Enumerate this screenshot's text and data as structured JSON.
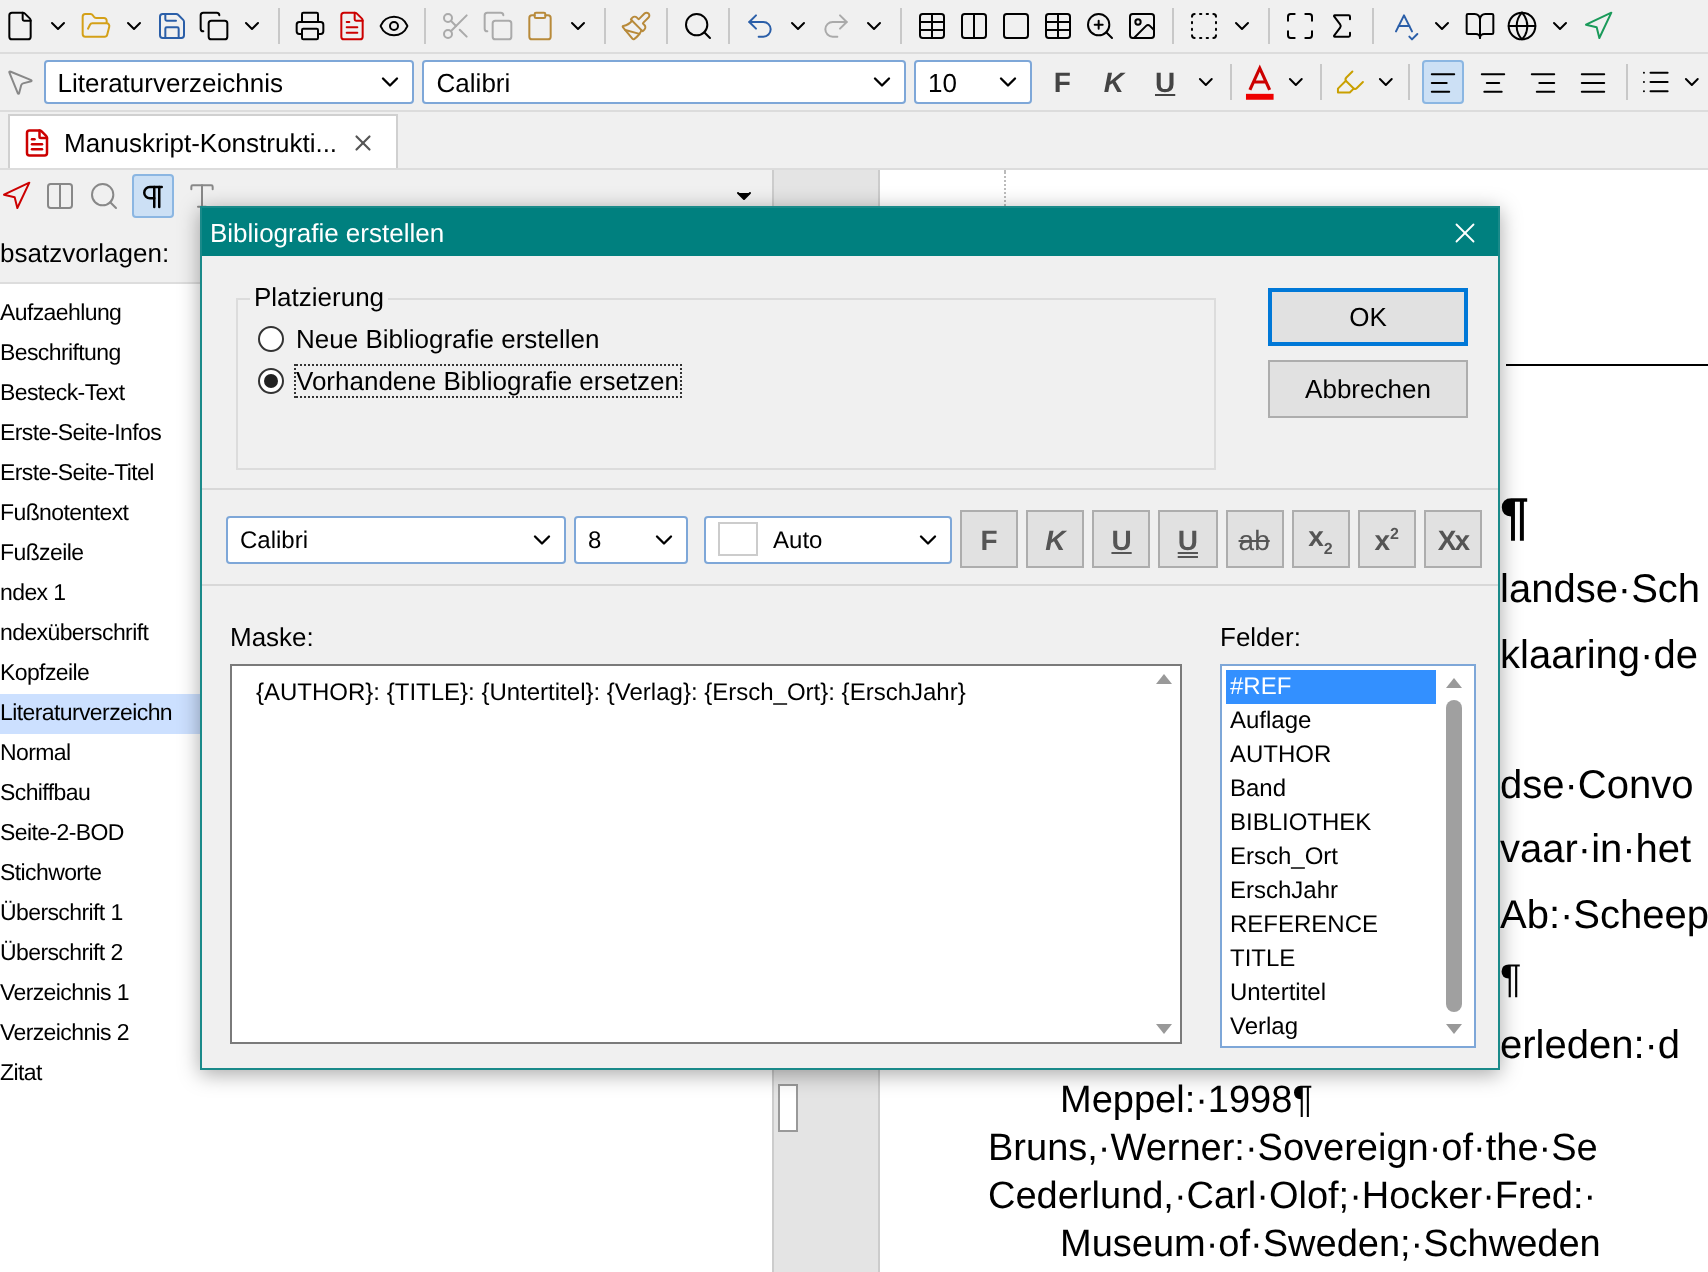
{
  "format_toolbar": {
    "paragraph_style": "Literaturverzeichnis",
    "font": "Calibri",
    "size": "10",
    "buttons": [
      {
        "label": "F",
        "kind": "bold"
      },
      {
        "label": "K",
        "kind": "italic"
      },
      {
        "label": "U",
        "kind": "underline"
      }
    ],
    "alignment": [
      {
        "selected": true
      },
      {
        "selected": false
      },
      {
        "selected": false
      },
      {
        "selected": false
      }
    ]
  },
  "document_tab": {
    "title": "Manuskript-Konstrukti..."
  },
  "styles_panel": {
    "heading": "bsatzvorlagen:",
    "items": [
      {
        "label": "Aufzaehlung",
        "selected": false
      },
      {
        "label": "Beschriftung",
        "selected": false
      },
      {
        "label": "Besteck-Text",
        "selected": false
      },
      {
        "label": "Erste-Seite-Infos",
        "selected": false
      },
      {
        "label": "Erste-Seite-Titel",
        "selected": false
      },
      {
        "label": "Fußnotentext",
        "selected": false
      },
      {
        "label": "Fußzeile",
        "selected": false
      },
      {
        "label": "ndex 1",
        "selected": false
      },
      {
        "label": "ndexüberschrift",
        "selected": false
      },
      {
        "label": "Kopfzeile",
        "selected": false
      },
      {
        "label": "Literaturverzeichn",
        "selected": true
      },
      {
        "label": "Normal",
        "selected": false
      },
      {
        "label": "Schiffbau",
        "selected": false
      },
      {
        "label": "Seite-2-BOD",
        "selected": false
      },
      {
        "label": "Stichworte",
        "selected": false
      },
      {
        "label": "Überschrift 1",
        "selected": false
      },
      {
        "label": "Überschrift 2",
        "selected": false
      },
      {
        "label": "Verzeichnis 1",
        "selected": false
      },
      {
        "label": "Verzeichnis 2",
        "selected": false
      },
      {
        "label": "Zitat",
        "selected": false
      }
    ]
  },
  "document": {
    "lines": [
      {
        "text": "¶",
        "kind": "heading",
        "spaced": false
      },
      {
        "text": "landse·Sch",
        "kind": "behind",
        "spaced": false
      },
      {
        "text": "klaaring·de",
        "kind": "behind",
        "spaced": false
      },
      {
        "text": "dse·Convo",
        "kind": "behind",
        "spaced": true
      },
      {
        "text": "vaar·in·het",
        "kind": "behind",
        "spaced": false
      },
      {
        "text": "Ab:·Scheep",
        "kind": "behind",
        "spaced": false
      },
      {
        "text": "¶",
        "kind": "behind",
        "spaced": false
      },
      {
        "text": "erleden:·d",
        "kind": "behind",
        "spaced": false
      },
      {
        "text": "Meppel:·1998¶",
        "kind": "indented",
        "spaced": false
      },
      {
        "text": "Bruns,·Werner:·Sovereign·of·the·Se",
        "kind": "normal",
        "spaced": false
      },
      {
        "text": "Cederlund,·Carl·Olof;·Hocker·Fred:·",
        "kind": "normal",
        "spaced": false
      },
      {
        "text": "Museum·of·Sweden;·Schweden",
        "kind": "indented",
        "spaced": false
      }
    ]
  },
  "dialog": {
    "title": "Bibliografie erstellen",
    "placement": {
      "legend": "Platzierung",
      "options": [
        {
          "label": "Neue Bibliografie erstellen",
          "selected": false
        },
        {
          "label": "Vorhandene Bibliografie ersetzen",
          "selected": true
        }
      ]
    },
    "buttons": [
      {
        "label": "OK",
        "default": true
      },
      {
        "label": "Abbrechen",
        "default": false
      }
    ],
    "font": "Calibri",
    "size": "8",
    "colour_setting": "Auto",
    "format_buttons": [
      {
        "label": "F",
        "kind": "bold"
      },
      {
        "label": "K",
        "kind": "italic"
      },
      {
        "label": "U",
        "kind": "underline"
      },
      {
        "label": "U",
        "kind": "double"
      },
      {
        "label": "ab",
        "kind": "strike"
      },
      {
        "label": "x$_{2}$",
        "kind": "sub"
      },
      {
        "label": "x$^{2}$",
        "kind": "sup"
      },
      {
        "label": "Xx",
        "kind": "caps"
      }
    ],
    "mask": {
      "label": "Maske:",
      "value": "{AUTHOR}: {TITLE}: {Untertitel}: {Verlag}: {Ersch_Ort}: {ErschJahr}"
    },
    "fields": {
      "label": "Felder:",
      "items": [
        {
          "label": "#REF",
          "selected": true
        },
        {
          "label": "Auflage",
          "selected": false
        },
        {
          "label": "AUTHOR",
          "selected": false
        },
        {
          "label": "Band",
          "selected": false
        },
        {
          "label": "BIBLIOTHEK",
          "selected": false
        },
        {
          "label": "Ersch_Ort",
          "selected": false
        },
        {
          "label": "ErschJahr",
          "selected": false
        },
        {
          "label": "REFERENCE",
          "selected": false
        },
        {
          "label": "TITLE",
          "selected": false
        },
        {
          "label": "Untertitel",
          "selected": false
        },
        {
          "label": "Verlag",
          "selected": false
        }
      ]
    }
  }
}
